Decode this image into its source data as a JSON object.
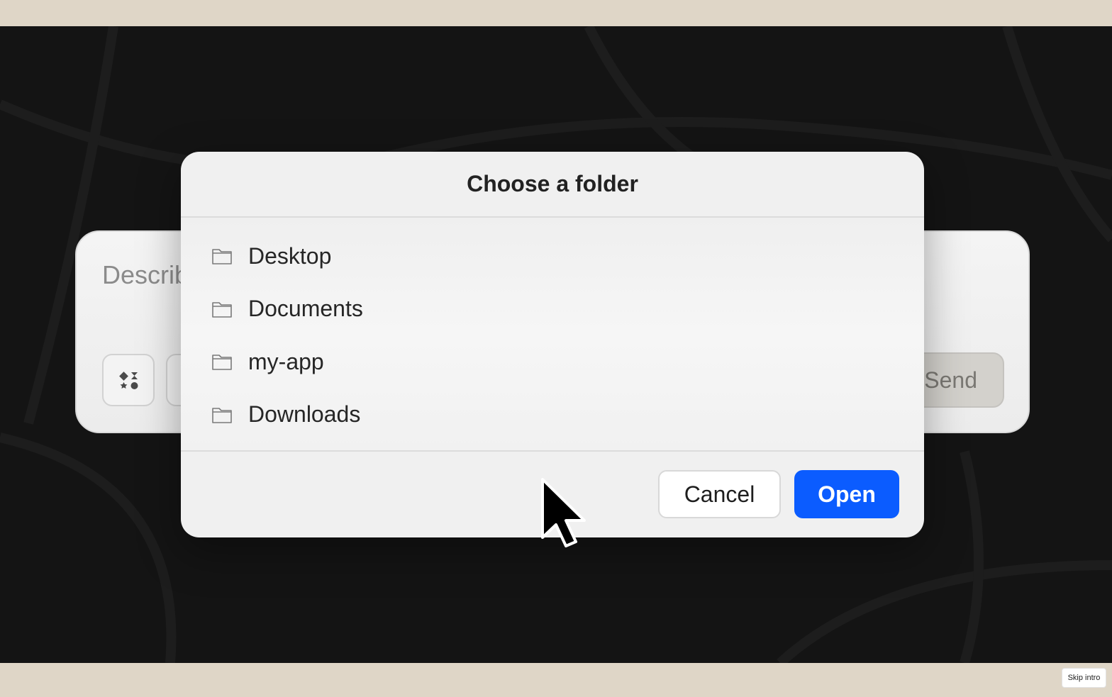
{
  "background_card": {
    "placeholder": "Describ",
    "send_label": "Send"
  },
  "dialog": {
    "title": "Choose a folder",
    "folders": [
      {
        "name": "Desktop"
      },
      {
        "name": "Documents"
      },
      {
        "name": "my-app"
      },
      {
        "name": "Downloads"
      }
    ],
    "cancel_label": "Cancel",
    "open_label": "Open"
  },
  "skip_intro_label": "Skip intro",
  "colors": {
    "accent": "#0b5cff",
    "frame": "#dfd6c7",
    "stage": "#141414"
  },
  "icons": {
    "folder": "folder-icon",
    "tools": "shapes-icon",
    "cursor": "mouse-pointer-icon"
  }
}
